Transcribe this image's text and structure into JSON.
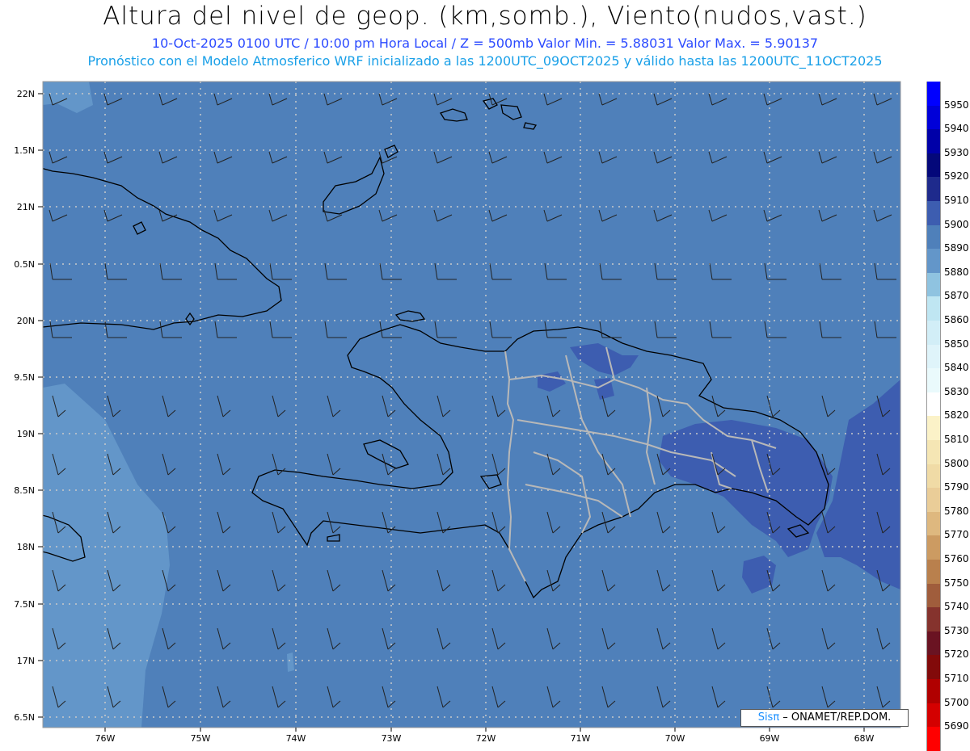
{
  "title": "Altura del nivel de geop. (km,somb.), Viento(nudos,vast.)",
  "subtitle": "10-Oct-2025  0100 UTC / 10:00 pm Hora Local / Z = 500mb    Valor Min. = 5.88031  Valor Max. = 5.90137",
  "subtitle2": "Pronóstico con el Modelo Atmosferico WRF inicializado a las 1200UTC_09OCT2025 y válido hasta las  1200UTC_11OCT2025",
  "credit": {
    "brand": "Sisπ",
    "org": " – ONAMET/REP.DOM."
  },
  "map": {
    "lon_labels": [
      "76W",
      "75W",
      "74W",
      "73W",
      "72W",
      "71W",
      "70W",
      "69W",
      "68W"
    ],
    "lat_labels": [
      "22N",
      "1.5N",
      "21N",
      "0.5N",
      "20N",
      "9.5N",
      "19N",
      "8.5N",
      "18N",
      "7.5N",
      "17N",
      "6.5N"
    ],
    "background_color": "#4f80ba",
    "west_band_color": "#6396c9",
    "high_patch_color": "#3d5db0",
    "coast_color": "#000000",
    "border_color": "#b4b4b4"
  },
  "colorbar": {
    "levels": [
      "5950",
      "5940",
      "5930",
      "5920",
      "5910",
      "5900",
      "5890",
      "5880",
      "5870",
      "5860",
      "5850",
      "5840",
      "5830",
      "5820",
      "5810",
      "5800",
      "5790",
      "5780",
      "5770",
      "5760",
      "5750",
      "5740",
      "5730",
      "5720",
      "5710",
      "5700",
      "5690"
    ],
    "colors": [
      "#0000ff",
      "#0000d8",
      "#0000a8",
      "#04087a",
      "#1e2a8c",
      "#3d5db0",
      "#4f80ba",
      "#6396c9",
      "#8fc3e0",
      "#bfe6f2",
      "#d2eef7",
      "#dff4fa",
      "#eafafc",
      "#ffffff",
      "#fbf2c8",
      "#f5e6b4",
      "#f0dba6",
      "#eacd98",
      "#deb87f",
      "#cc9b62",
      "#b9804d",
      "#a05d3c",
      "#85332d",
      "#6a1322",
      "#820a0a",
      "#b00000",
      "#d40000",
      "#ff0000"
    ]
  }
}
